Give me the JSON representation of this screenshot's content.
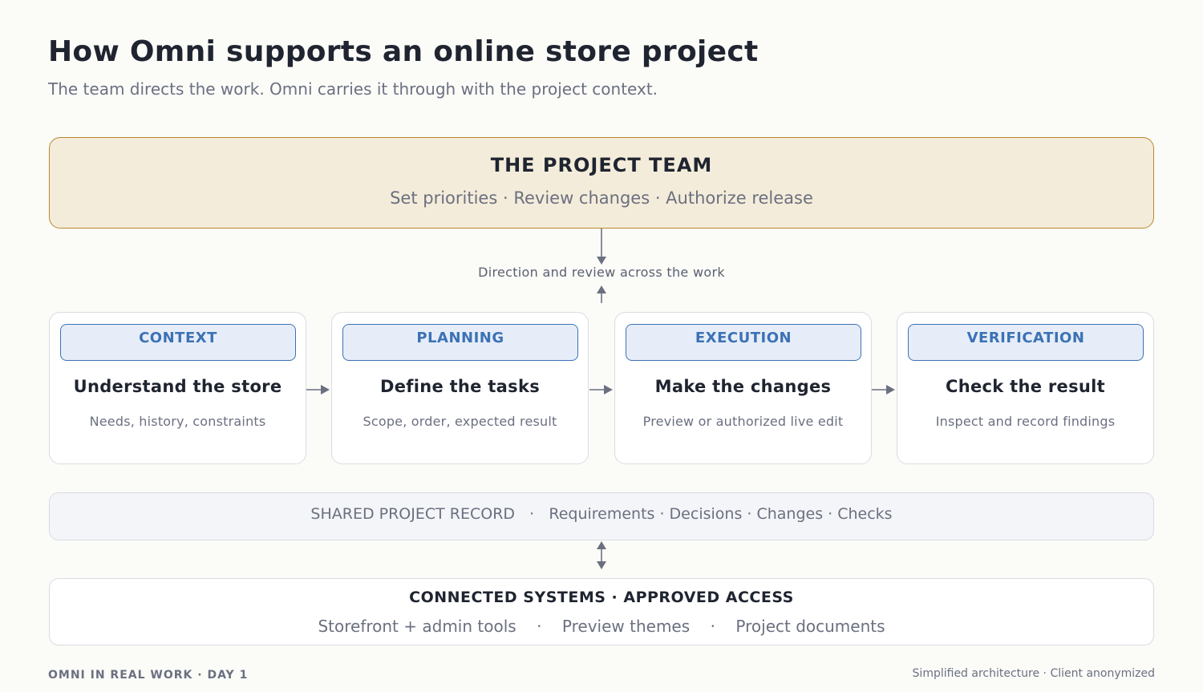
{
  "header": {
    "title": "How Omni supports an online store project",
    "subtitle": "The team directs the work. Omni carries it through with the project context."
  },
  "team": {
    "title": "THE PROJECT TEAM",
    "responsibilities": "Set priorities · Review changes · Authorize release"
  },
  "direction_label": "Direction and review across the work",
  "stages": [
    {
      "tag": "CONTEXT",
      "title": "Understand the store",
      "description": "Needs, history, constraints"
    },
    {
      "tag": "PLANNING",
      "title": "Define the tasks",
      "description": "Scope, order, expected result"
    },
    {
      "tag": "EXECUTION",
      "title": "Make the changes",
      "description": "Preview or authorized live edit"
    },
    {
      "tag": "VERIFICATION",
      "title": "Check the result",
      "description": "Inspect and record findings"
    }
  ],
  "record": {
    "label": "SHARED PROJECT RECORD",
    "separator": "·",
    "items": "Requirements · Decisions · Changes · Checks"
  },
  "systems": {
    "title": "CONNECTED SYSTEMS · APPROVED ACCESS",
    "items": [
      "Storefront + admin tools",
      "Preview themes",
      "Project documents"
    ],
    "separator": "·"
  },
  "footer": {
    "left": "OMNI IN REAL WORK · DAY 1",
    "right": "Simplified architecture · Client anonymized"
  },
  "colors": {
    "team_fill": "#f4ecda",
    "team_border": "#b88a2e",
    "stage_accent": "#3c72b5",
    "stage_tag_fill": "#e6edf8",
    "arrow": "#6b7080"
  }
}
